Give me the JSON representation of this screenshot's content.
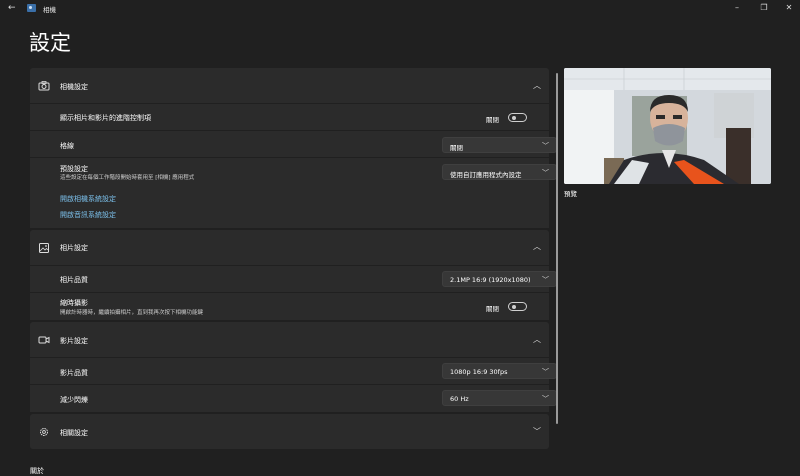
{
  "window": {
    "title": "相機",
    "back_icon": "back-arrow-icon",
    "app_icon": "camera-app-icon"
  },
  "page_title": "設定",
  "camera_settings": {
    "title": "相機設定",
    "icon": "camera-icon",
    "advanced_controls": {
      "label": "顯示相片和影片的進階控制項",
      "toggle_text": "關閉",
      "state": "off"
    },
    "grid": {
      "label": "格線",
      "value": "關閉"
    },
    "default_settings": {
      "label": "預設設定",
      "description": "這些設定在每個工作階段開始時套用至 [相機] 應用程式",
      "value": "使用自訂應用程式內設定"
    },
    "links": [
      "開啟相機系統設定",
      "開啟音訊系統設定"
    ]
  },
  "photo_settings": {
    "title": "相片設定",
    "icon": "image-icon",
    "quality": {
      "label": "相片品質",
      "value": "2.1MP 16:9 (1920x1080)"
    },
    "timelapse": {
      "label": "縮時攝影",
      "description": "開啟計時器時，繼續拍攝相片，直到我再次按下相機功能鍵",
      "toggle_text": "關閉",
      "state": "off"
    }
  },
  "video_settings": {
    "title": "影片設定",
    "icon": "video-camera-icon",
    "quality": {
      "label": "影片品質",
      "value": "1080p 16:9 30fps"
    },
    "flicker": {
      "label": "減少閃爍",
      "value": "60 Hz"
    }
  },
  "related_settings": {
    "title": "相關設定",
    "icon": "gear-icon"
  },
  "preview": {
    "label": "預覽"
  },
  "footer": {
    "about": "關於"
  },
  "colors": {
    "background": "#202020",
    "card": "#2b2b2b",
    "link": "#7cc1ec"
  }
}
